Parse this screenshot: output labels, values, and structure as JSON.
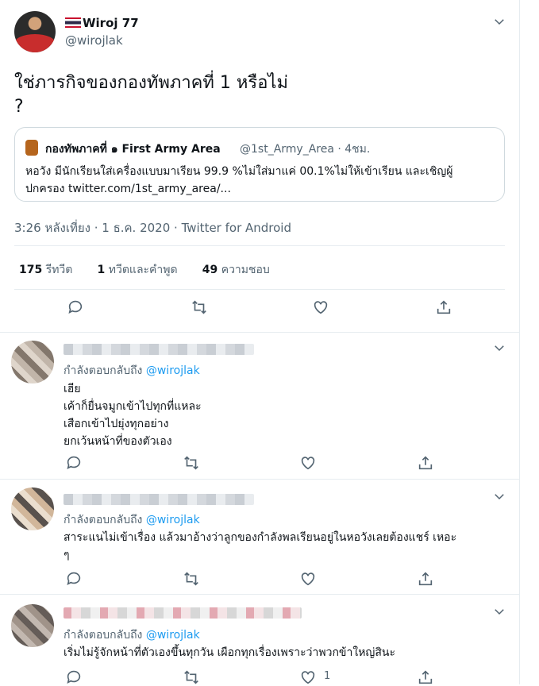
{
  "author": {
    "name": "Wiroj 77",
    "handle": "@wirojlak"
  },
  "tweet": {
    "text_line1": "ใช่ภารกิจของกองทัพภาคที่ 1 หรือไม่",
    "text_line2": "?",
    "quote": {
      "name": "กองทัพภาคที่ ๑ First Army Area",
      "handle_time": "@1st_Army_Area · 4ชม.",
      "text_line1": "หอวัง มีนักเรียนใส่เครื่องแบบมาเรียน 99.9  %ไม่ใส่มาแค่ 00.1%ไม่ให้เข้าเรียน และเชิญผู้",
      "text_line2": "ปกครอง twitter.com/1st_army_area/..."
    },
    "meta": "3:26 หลังเที่ยง · 1 ธ.ค. 2020 · Twitter for Android",
    "stats": {
      "retweets_count": "175",
      "retweets_label": "รีทวีต",
      "quotes_count": "1",
      "quotes_label": "ทวีตและคำพูด",
      "likes_count": "49",
      "likes_label": "ความชอบ"
    }
  },
  "replies": [
    {
      "replying_prefix": "กำลังตอบกลับถึง",
      "replying_to": "@wirojlak",
      "text": "เฮีย\nเค้าก็ยื่นจมูกเข้าไปทุกที่แหละ\nเสือกเข้าไปยุ่งทุกอย่าง\nยกเว้นหน้าที่ของตัวเอง"
    },
    {
      "replying_prefix": "กำลังตอบกลับถึง",
      "replying_to": "@wirojlak",
      "text": "สาระแนไม่เข้าเรื่อง แล้วมาอ้างว่าลูกของกำลังพลเรียนอยู่ในหอวังเลยต้องแชร์ เหอะ\nๆ"
    },
    {
      "replying_prefix": "กำลังตอบกลับถึง",
      "replying_to": "@wirojlak",
      "text": "เริ่มไม่รู้จักหน้าที่ตัวเองขึ้นทุกวัน เผือกทุกเรื่องเพราะว่าพวกข้าใหญ่สินะ",
      "like_count": "1"
    }
  ],
  "icons": [
    "chevron-down-icon",
    "reply-icon",
    "retweet-icon",
    "like-icon",
    "share-icon"
  ]
}
